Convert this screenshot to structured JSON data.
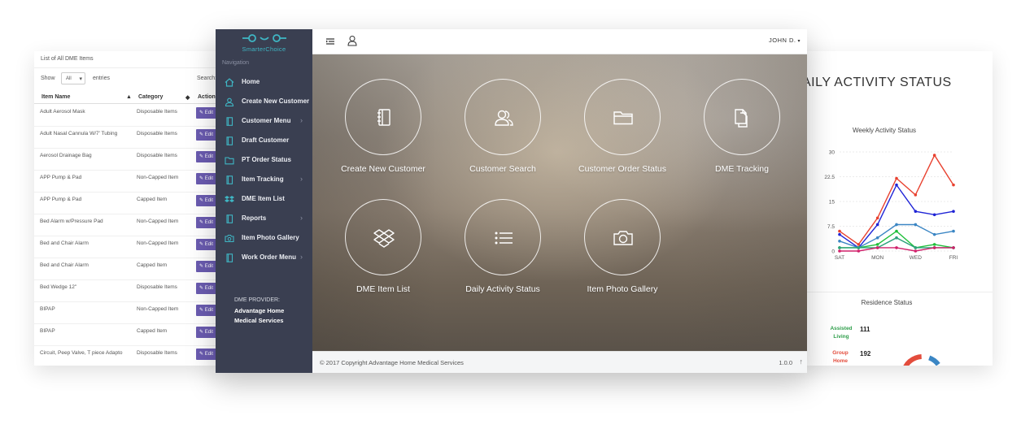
{
  "dme_list": {
    "title": "List of All DME Items",
    "show_label": "Show",
    "page_size": "All",
    "entries_label": "entries",
    "search_label": "Search:",
    "columns": [
      "Item Name",
      "Category",
      "Action"
    ],
    "edit_label": "Edit",
    "rows": [
      {
        "name": "Adult Aerosol Mask",
        "category": "Disposable Items"
      },
      {
        "name": "Adult Nasal Cannula W/7' Tubing",
        "category": "Disposable Items"
      },
      {
        "name": "Aerosol Drainage Bag",
        "category": "Disposable Items"
      },
      {
        "name": "APP Pump & Pad",
        "category": "Non-Capped Item"
      },
      {
        "name": "APP Pump & Pad",
        "category": "Capped Item"
      },
      {
        "name": "Bed Alarm w/Pressure Pad",
        "category": "Non-Capped Item"
      },
      {
        "name": "Bed and Chair Alarm",
        "category": "Non-Capped Item"
      },
      {
        "name": "Bed and Chair Alarm",
        "category": "Capped Item"
      },
      {
        "name": "Bed Wedge 12\"",
        "category": "Disposable Items"
      },
      {
        "name": "BIPAP",
        "category": "Non-Capped Item"
      },
      {
        "name": "BIPAP",
        "category": "Capped Item"
      },
      {
        "name": "Circuit, Peep Valve, T piece Adapto",
        "category": "Disposable Items"
      }
    ]
  },
  "sidebar": {
    "logo_text": "SmarterChoice",
    "nav_caption": "Navigation",
    "items": [
      {
        "label": "Home",
        "icon": "home-icon",
        "submenu": false
      },
      {
        "label": "Create New Customer",
        "icon": "user-icon",
        "submenu": false
      },
      {
        "label": "Customer Menu",
        "icon": "book-icon",
        "submenu": true
      },
      {
        "label": "Draft Customer",
        "icon": "book-icon",
        "submenu": false
      },
      {
        "label": "PT Order Status",
        "icon": "folder-icon",
        "submenu": false
      },
      {
        "label": "Item Tracking",
        "icon": "book-icon",
        "submenu": true
      },
      {
        "label": "DME Item List",
        "icon": "dropbox-icon",
        "submenu": false
      },
      {
        "label": "Reports",
        "icon": "book-icon",
        "submenu": true
      },
      {
        "label": "Item Photo Gallery",
        "icon": "camera-icon",
        "submenu": false
      },
      {
        "label": "Work Order Menu",
        "icon": "book-icon",
        "submenu": true
      }
    ],
    "provider_caption": "DME PROVIDER:",
    "provider_name": "Advantage Home Medical Services"
  },
  "topbar": {
    "user_name": "JOHN D.",
    "caret": "▾"
  },
  "tiles": [
    {
      "label": "Create New Customer",
      "icon": "notebook-icon"
    },
    {
      "label": "Customer Search",
      "icon": "users-icon"
    },
    {
      "label": "Customer Order Status",
      "icon": "folder-icon"
    },
    {
      "label": "DME Tracking",
      "icon": "documents-icon"
    },
    {
      "label": "DME Item List",
      "icon": "dropbox-icon"
    },
    {
      "label": "Daily Activity Status",
      "icon": "list-icon"
    },
    {
      "label": "Item Photo Gallery",
      "icon": "camera-icon"
    }
  ],
  "footer": {
    "copyright": "© 2017 Copyright Advantage Home Medical Services",
    "version": "1.0.0",
    "scroll_up": "↑"
  },
  "daily_activity": {
    "title": "AILY ACTIVITY STATUS",
    "chart_title": "Weekly Activity Status",
    "residence_title": "Residence Status",
    "residence": [
      {
        "label": "Assisted Living",
        "value": "111",
        "color": "#2e9e4a"
      },
      {
        "label": "Group Home",
        "value": "192",
        "color": "#e34c3c"
      }
    ]
  },
  "chart_data": {
    "type": "line",
    "title": "Weekly Activity Status",
    "x": [
      "SAT",
      "SUN",
      "MON",
      "TUE",
      "WED",
      "THU",
      "FRI"
    ],
    "x_tick_labels": [
      "SAT",
      "MON",
      "WED",
      "FRI"
    ],
    "y_ticks": [
      "0",
      "7.5",
      "15",
      "22.5",
      "30"
    ],
    "ylim": [
      0,
      30
    ],
    "grid": true,
    "series": [
      {
        "color": "#e8412f",
        "values": [
          6,
          2,
          10,
          22,
          17,
          29,
          20
        ]
      },
      {
        "color": "#1f24d6",
        "values": [
          5,
          1,
          8,
          20,
          12,
          11,
          12
        ]
      },
      {
        "color": "#3b86c4",
        "values": [
          3,
          1,
          4,
          8,
          8,
          5,
          6
        ]
      },
      {
        "color": "#1fbf3a",
        "values": [
          1,
          1,
          2,
          6,
          1,
          2,
          1
        ]
      },
      {
        "color": "#2da27a",
        "values": [
          1,
          1,
          1,
          4,
          1,
          1,
          1
        ]
      },
      {
        "color": "#d0206a",
        "values": [
          0,
          0,
          1,
          1,
          0,
          1,
          1
        ]
      }
    ]
  }
}
